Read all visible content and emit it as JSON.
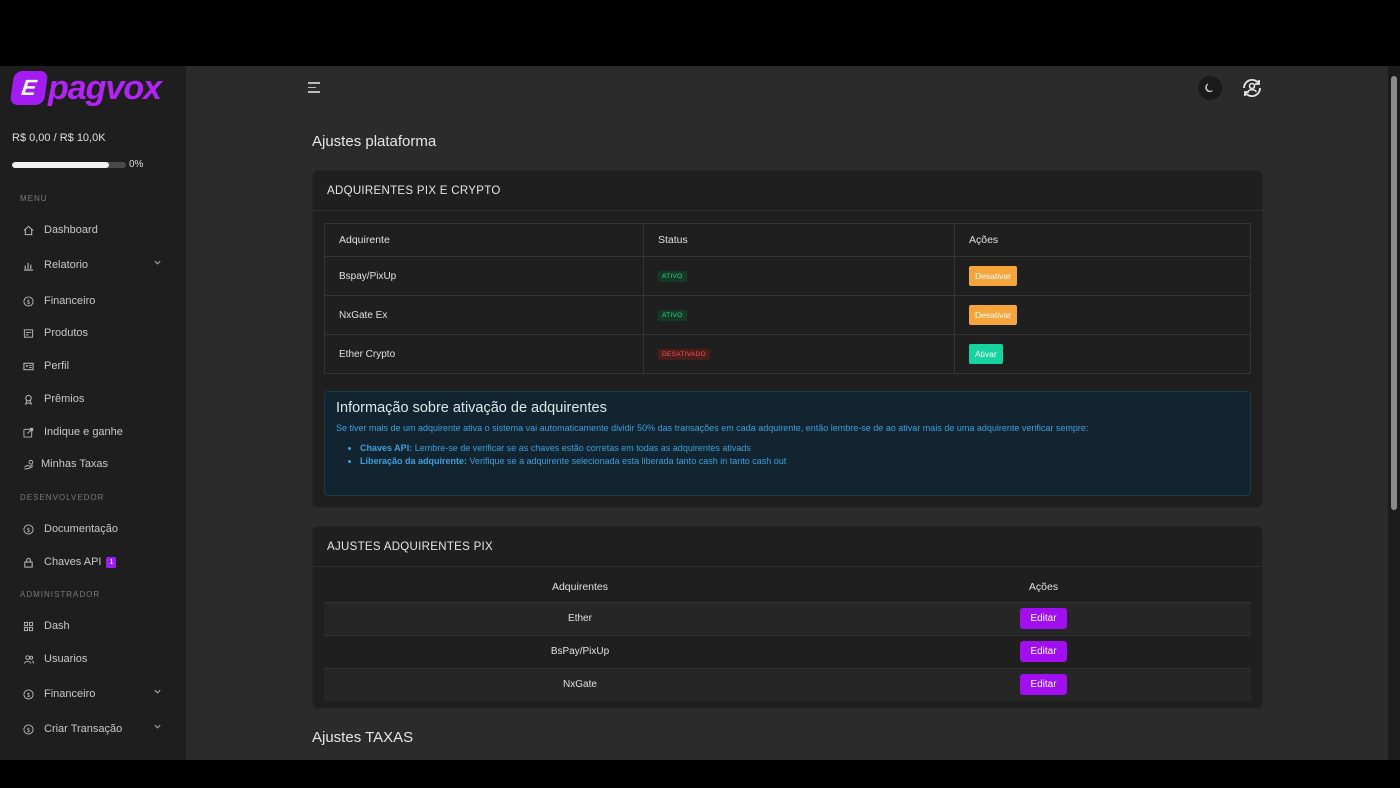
{
  "brand": {
    "name": "pagvox",
    "mark": "E"
  },
  "sidebar": {
    "balance": "R$ 0,00 / R$ 10,0K",
    "progress_pct": "0%",
    "progress_value": 0.85,
    "sections": {
      "menu": "MENU",
      "dev": "DESENVOLVEDOR",
      "admin": "ADMINISTRADOR"
    },
    "items": {
      "dashboard": "Dashboard",
      "relatorio": "Relatorio",
      "financeiro": "Financeiro",
      "produtos": "Produtos",
      "perfil": "Perfil",
      "premios": "Prêmios",
      "indique": "Indique e ganhe",
      "taxas": "Minhas Taxas",
      "docs": "Documentação",
      "chaves": "Chaves API",
      "chaves_badge": "1",
      "dash": "Dash",
      "usuarios": "Usuarios",
      "financeiro_admin": "Financeiro",
      "criar_transacao": "Criar Transação"
    }
  },
  "page": {
    "title": "Ajustes plataforma",
    "section_taxas": "Ajustes TAXAS"
  },
  "card1": {
    "header": "ADQUIRENTES PIX E CRYPTO",
    "columns": [
      "Adquirente",
      "Status",
      "Ações"
    ],
    "rows": [
      {
        "name": "Bspay/PixUp",
        "status": "ATIVO",
        "action": "Desativar"
      },
      {
        "name": "NxGate Ex",
        "status": "ATIVO",
        "action": "Desativar"
      },
      {
        "name": "Ether Crypto",
        "status": "DESATIVADO",
        "action": "Ativar"
      }
    ],
    "info": {
      "title": "Informação sobre ativação de adquirentes",
      "text": "Se tiver mais de um adquirente ativa o sistema vai automaticamente dividir 50% das transações em cada adquirente, então lembre-se de ao ativar mais de uma adquirente verificar sempre:",
      "bullets": [
        {
          "label": "Chaves API:",
          "text": " Lembre-se de verificar se as chaves estão corretas em todas as adquirentes ativads"
        },
        {
          "label": "Liberação da adquirente:",
          "text": " Verifique se a adquirente selecionada esta liberada tanto cash in tanto cash out"
        }
      ]
    }
  },
  "card2": {
    "header": "AJUSTES ADQUIRENTES PIX",
    "columns": [
      "Adquirentes",
      "Ações"
    ],
    "rows": [
      {
        "name": "Ether",
        "action": "Editar"
      },
      {
        "name": "BsPay/PixUp",
        "action": "Editar"
      },
      {
        "name": "NxGate",
        "action": "Editar"
      }
    ]
  },
  "colors": {
    "brand": "#a21cf3",
    "orange": "#f5a53a",
    "green": "#17d3a0",
    "purple": "#a10ef0"
  }
}
